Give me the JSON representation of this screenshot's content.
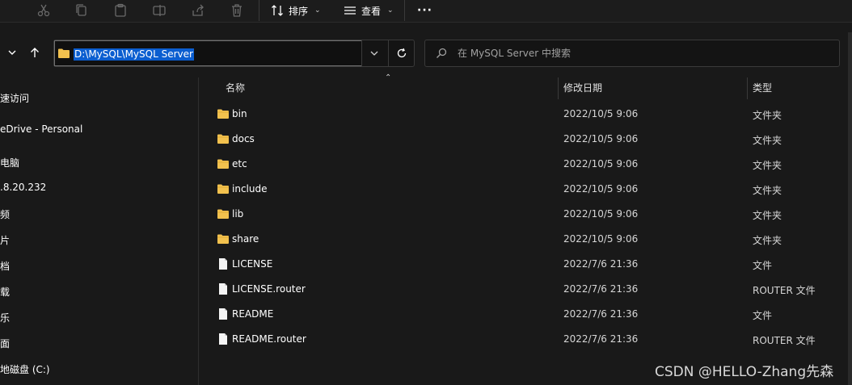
{
  "toolbar": {
    "sort_label": "排序",
    "view_label": "查看",
    "more_label": "···"
  },
  "address": {
    "path": "D:\\MySQL\\MySQL Server"
  },
  "search": {
    "placeholder": "在 MySQL Server 中搜索"
  },
  "sidebar": {
    "items": [
      {
        "label": "速访问"
      },
      {
        "label": "eDrive - Personal"
      },
      {
        "label": "电脑"
      },
      {
        "label": ".8.20.232"
      },
      {
        "label": "频"
      },
      {
        "label": "片"
      },
      {
        "label": "档"
      },
      {
        "label": "载"
      },
      {
        "label": "乐"
      },
      {
        "label": "面"
      },
      {
        "label": "地磁盘 (C:)"
      }
    ]
  },
  "columns": {
    "name": "名称",
    "date": "修改日期",
    "type": "类型"
  },
  "files": [
    {
      "name": "bin",
      "date": "2022/10/5 9:06",
      "type": "文件夹",
      "icon": "folder-icon"
    },
    {
      "name": "docs",
      "date": "2022/10/5 9:06",
      "type": "文件夹",
      "icon": "folder-icon"
    },
    {
      "name": "etc",
      "date": "2022/10/5 9:06",
      "type": "文件夹",
      "icon": "folder-icon"
    },
    {
      "name": "include",
      "date": "2022/10/5 9:06",
      "type": "文件夹",
      "icon": "folder-icon"
    },
    {
      "name": "lib",
      "date": "2022/10/5 9:06",
      "type": "文件夹",
      "icon": "folder-icon"
    },
    {
      "name": "share",
      "date": "2022/10/5 9:06",
      "type": "文件夹",
      "icon": "folder-icon"
    },
    {
      "name": "LICENSE",
      "date": "2022/7/6 21:36",
      "type": "文件",
      "icon": "file-icon"
    },
    {
      "name": "LICENSE.router",
      "date": "2022/7/6 21:36",
      "type": "ROUTER 文件",
      "icon": "file-icon"
    },
    {
      "name": "README",
      "date": "2022/7/6 21:36",
      "type": "文件",
      "icon": "file-icon"
    },
    {
      "name": "README.router",
      "date": "2022/7/6 21:36",
      "type": "ROUTER 文件",
      "icon": "file-icon"
    }
  ],
  "watermark": "CSDN @HELLO-Zhang先森",
  "colors": {
    "background": "#191919",
    "selection": "#0b5ed0",
    "folder": "#f2c14e"
  }
}
